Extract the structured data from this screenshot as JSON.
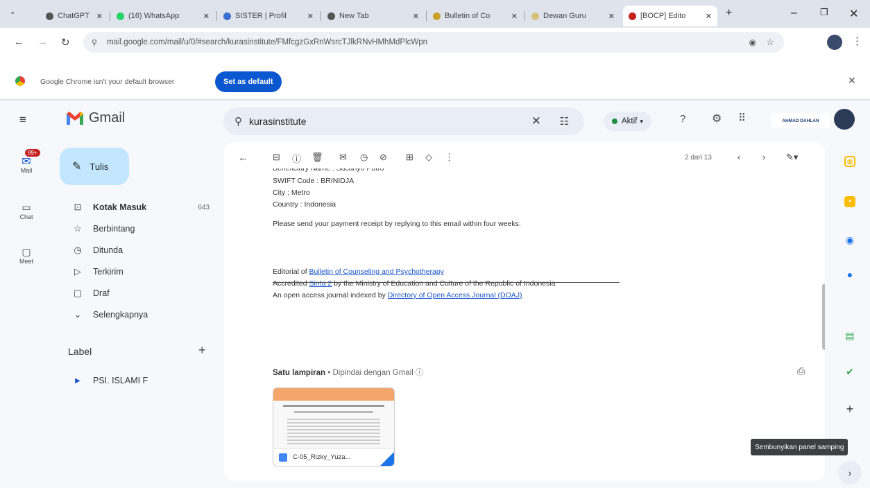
{
  "browser": {
    "tabs": [
      {
        "title": "ChatGPT",
        "color": "#555555"
      },
      {
        "title": "(16) WhatsApp",
        "color": "#25d366"
      },
      {
        "title": "SISTER | Profil",
        "color": "#3b6fd1"
      },
      {
        "title": "New Tab",
        "color": "#555555"
      },
      {
        "title": "Bulletin of Co",
        "color": "#c9a227"
      },
      {
        "title": "Dewan Guru",
        "color": "#d4c27a"
      },
      {
        "title": "[BOCP] Edito",
        "color": "#c5221f"
      }
    ],
    "new_tab": "+",
    "url": "mail.google.com/mail/u/0/#search/kurasinstitute/FMfcgzGxRnWsrcTJlkRNvHMhMdPlcWpn",
    "default_notice": "Google Chrome isn't your default browser",
    "default_button": "Set as default"
  },
  "gmail": {
    "logo_text": "Gmail",
    "rail": [
      {
        "label": "Mail",
        "badge": "99+"
      },
      {
        "label": "Chat"
      },
      {
        "label": "Meet"
      }
    ],
    "compose": "Tulis",
    "nav": [
      {
        "label": "Kotak Masuk",
        "count": "643",
        "icon": "inbox-icon"
      },
      {
        "label": "Berbintang",
        "icon": "star-icon"
      },
      {
        "label": "Ditunda",
        "icon": "clock-icon"
      },
      {
        "label": "Terkirim",
        "icon": "send-icon"
      },
      {
        "label": "Draf",
        "icon": "draft-icon"
      },
      {
        "label": "Selengkapnya",
        "icon": "chevron-down-icon"
      }
    ],
    "labels_heading": "Label",
    "labels": [
      {
        "label": "PSI. ISLAMI F",
        "color": "#1a55c9"
      }
    ],
    "search_value": "kurasinstitute",
    "status": "Aktif",
    "account_name": "AHMAD DAHLAN",
    "pager": "2 dari 13",
    "email": {
      "lines_top": [
        "Beneficiary Name : Sucahyo Putro",
        "SWIFT Code : BRINIDJA",
        "City : Metro",
        "Country : Indonesia"
      ],
      "payment_note": "Please send your payment receipt by replying to this email within four weeks.",
      "editorial_prefix": "Editorial of ",
      "editorial_link": "Bulletin of Counseling and Psychotherapy",
      "accredited_prefix": "Accredited ",
      "accredited_link": "Sinta 2",
      "accredited_suffix": " by the Ministry of Education and Culture of the Republic of Indonesia",
      "doaj_prefix": "An open access journal indexed by ",
      "doaj_link": "Directory of Open Access Journal (DOAJ)"
    },
    "attachments_heading": "Satu lampiran",
    "attachments_scan": " • Dipindai dengan Gmail ⓘ",
    "attachment_name": "C-05_Rizky_Yuza...",
    "tooltip": "Sembunyikan panel samping"
  }
}
